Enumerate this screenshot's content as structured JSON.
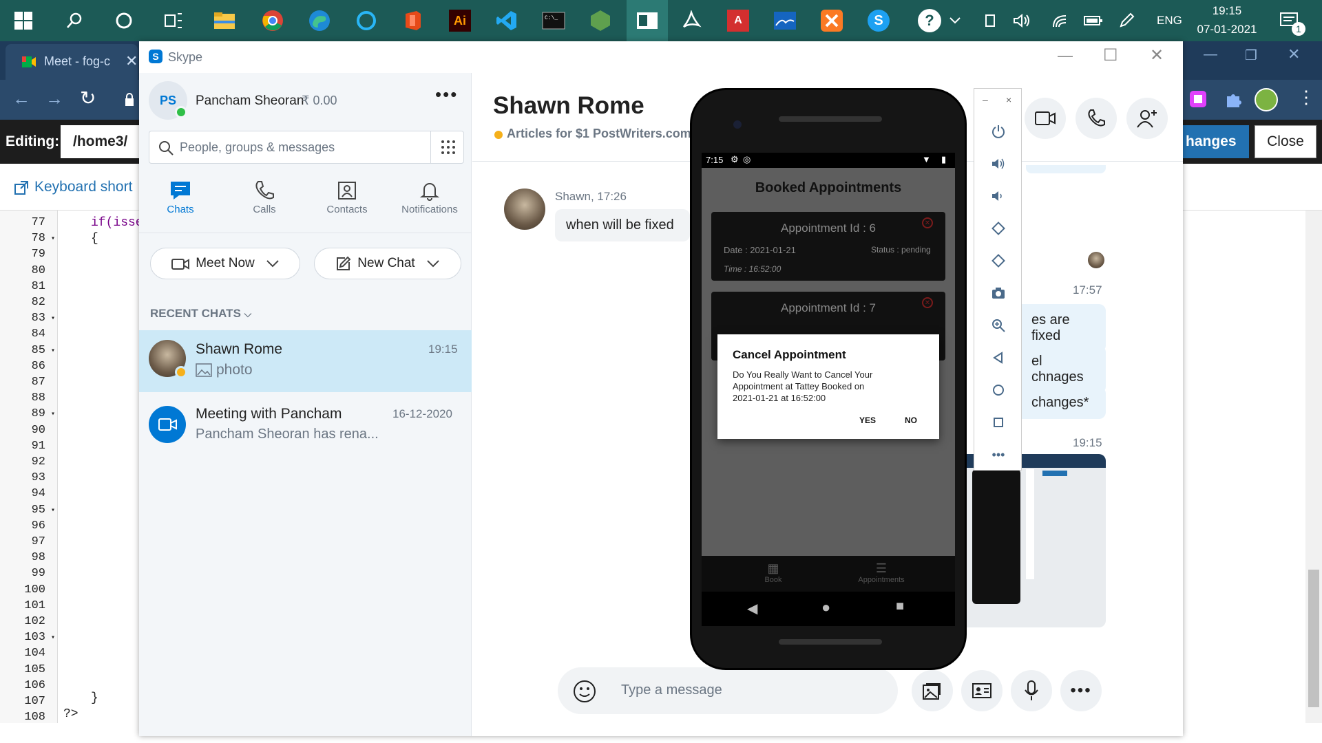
{
  "taskbar": {
    "icons": [
      "windows-start-icon",
      "search-icon",
      "cortana-icon",
      "task-view-icon",
      "file-explorer-icon",
      "chrome-icon",
      "edge-icon",
      "cortana-circle-icon",
      "office-icon",
      "illustrator-icon",
      "vscode-icon",
      "terminal-icon",
      "nodejs-icon",
      "active-app-icon",
      "acrobat-icon",
      "adobe-reader-icon",
      "photos-icon",
      "xampp-icon",
      "skype-icon",
      "help-icon"
    ],
    "language": "ENG",
    "time": "19:15",
    "date": "07-01-2021",
    "notification_count": "1"
  },
  "background_browser": {
    "tab_title": "Meet - fog-c",
    "editing_label": "Editing:",
    "editing_path": "/home3/",
    "save_button": "hanges",
    "close_button": "Close",
    "keyboard_shortcuts": "Keyboard short",
    "line_numbers": [
      "77",
      "78",
      "79",
      "80",
      "81",
      "82",
      "83",
      "84",
      "85",
      "86",
      "87",
      "88",
      "89",
      "90",
      "91",
      "92",
      "93",
      "94",
      "95",
      "96",
      "97",
      "98",
      "99",
      "100",
      "101",
      "102",
      "103",
      "104",
      "105",
      "106",
      "107",
      "108"
    ],
    "code_line_77": "if(isse",
    "code_line_78": "{",
    "code_line_107": "}",
    "code_line_108": "?>"
  },
  "skype": {
    "window_title": "Skype",
    "profile": {
      "initials": "PS",
      "name": "Pancham Sheoran",
      "credit": "₹ 0.00"
    },
    "search_placeholder": "People, groups & messages",
    "nav_tabs": [
      {
        "label": "Chats",
        "icon": "chat-icon"
      },
      {
        "label": "Calls",
        "icon": "phone-icon"
      },
      {
        "label": "Contacts",
        "icon": "contacts-icon"
      },
      {
        "label": "Notifications",
        "icon": "bell-icon"
      }
    ],
    "meet_now": "Meet Now",
    "new_chat": "New Chat",
    "recent_chats_label": "RECENT CHATS",
    "recent_chats": [
      {
        "name": "Shawn Rome",
        "time": "19:15",
        "preview": "photo"
      },
      {
        "name": "Meeting with Pancham",
        "time": "16-12-2020",
        "preview": "Pancham Sheoran has rena..."
      }
    ],
    "conversation": {
      "contact_name": "Shawn Rome",
      "mood_message": "Articles for $1 PostWriters.com",
      "incoming_meta": "Shawn, 17:26",
      "incoming_text": "when will be fixed",
      "time_1757": "17:57",
      "out_1": "es are fixed",
      "out_2": "el chnages",
      "out_3": "changes*",
      "time_1915": "19:15",
      "input_placeholder": "Type a message"
    },
    "colors": {
      "accent": "#0078d4",
      "selected_chat": "#cde9f7",
      "online": "#2fbf48",
      "away": "#f5b01b"
    }
  },
  "emulator": {
    "status_time": "7:15",
    "screen_title": "Booked Appointments",
    "card1": {
      "id_label": "Appointment Id : 6",
      "date": "Date : 2021-01-21",
      "status": "Status : pending",
      "time": "Time : 16:52:00"
    },
    "card2": {
      "id_label": "Appointment Id : 7"
    },
    "dialog": {
      "title": "Cancel Appointment",
      "body": "Do You Really Want to Cancel Your Appointment at Tattey Booked on 2021-01-21 at 16:52:00",
      "yes": "YES",
      "no": "NO"
    },
    "bottom_nav": [
      "Book",
      "Appointments"
    ]
  }
}
